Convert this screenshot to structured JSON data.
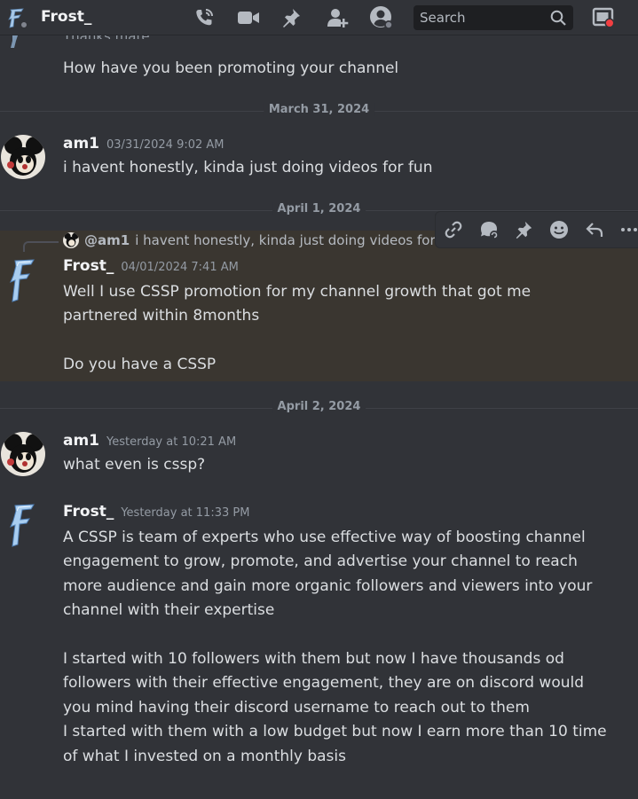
{
  "header": {
    "title": "Frost_",
    "search_placeholder": "Search",
    "icons": [
      "voice-call-icon",
      "video-call-icon",
      "pin-icon",
      "add-friend-icon",
      "user-profile-icon",
      "search-icon",
      "inbox-icon"
    ]
  },
  "messages": {
    "m0": {
      "partial_text": "Thanks mate",
      "text": "How have you been promoting your channel"
    },
    "d1": "March 31, 2024",
    "m1": {
      "user": "am1",
      "time": "03/31/2024 9:02 AM",
      "text": "i havent honestly, kinda just doing videos for fun"
    },
    "d2": "April 1, 2024",
    "reply": {
      "user": "@am1",
      "text": "i havent honestly, kinda just doing videos for fun"
    },
    "m2": {
      "user": "Frost_",
      "time": "04/01/2024 7:41 AM",
      "line1": "Well I use CSSP promotion for my channel growth that got me",
      "line2": "partnered within 8months",
      "line3": "Do you have a CSSP"
    },
    "d3": "April 2, 2024",
    "m3": {
      "user": "am1",
      "time": "Yesterday at 10:21 AM",
      "text": "what even is cssp?"
    },
    "m4": {
      "user": "Frost_",
      "time": "Yesterday at 11:33 PM",
      "lines": [
        "A CSSP is team of experts who use effective way of boosting channel",
        "engagement to grow, promote, and advertise your channel to reach",
        "more audience and gain more organic followers and viewers into your",
        "channel with their expertise",
        "",
        "I started with 10 followers with them but now  I have thousands od",
        "followers with their effective engagement, they are on discord would",
        "you mind having their discord username to reach out to them",
        "I started with them with a low budget but now I earn more than 10 time",
        "of what I invested on a monthly basis"
      ]
    }
  },
  "toolbar_icons": [
    "copy-link-icon",
    "create-thread-icon",
    "pin-message-icon",
    "add-reaction-icon",
    "reply-icon",
    "more-icon"
  ],
  "colors": {
    "background": "#313338",
    "highlight": "#3a3630",
    "accent_red": "#f23f42"
  }
}
